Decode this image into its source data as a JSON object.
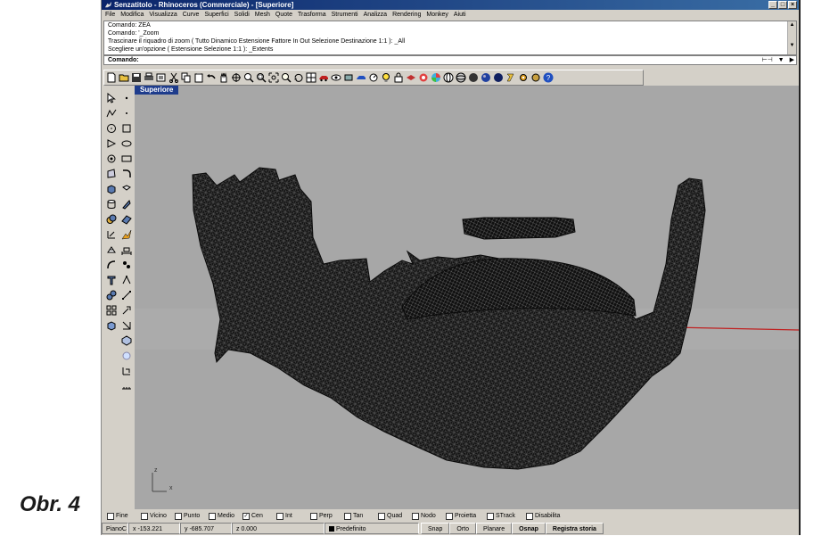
{
  "caption": "Obr. 4",
  "window": {
    "title": "Senzatitolo - Rhinoceros (Commerciale) - [Superiore]",
    "buttons": [
      "_",
      "□",
      "×"
    ]
  },
  "menu": [
    "File",
    "Modifica",
    "Visualizza",
    "Curve",
    "Superfici",
    "Solidi",
    "Mesh",
    "Quote",
    "Trasforma",
    "Strumenti",
    "Analizza",
    "Rendering",
    "Monkey",
    "Aiuti"
  ],
  "command_history": [
    "Comando: ZEA",
    "Comando: '_Zoom",
    "Trascinare il riquadro di zoom ( Tutto  Dinamico  Estensione  Fattore  In  Out  Selezione  Destinazione  1:1 ): _All",
    "Scegliere un'opzione ( Estensione  Selezione  1:1 ): _Extents"
  ],
  "command_prompt": "Comando:",
  "viewport": {
    "title": "Superiore",
    "axis_z": "z",
    "axis_x": "x"
  },
  "osnaps": [
    {
      "label": "Fine",
      "checked": false
    },
    {
      "label": "Vicino",
      "checked": false
    },
    {
      "label": "Punto",
      "checked": false
    },
    {
      "label": "Medio",
      "checked": false
    },
    {
      "label": "Cen",
      "checked": true
    },
    {
      "label": "Int",
      "checked": false
    },
    {
      "label": "Perp",
      "checked": false
    },
    {
      "label": "Tan",
      "checked": false
    },
    {
      "label": "Quad",
      "checked": false
    },
    {
      "label": "Nodo",
      "checked": false
    },
    {
      "label": "Proietta",
      "checked": false
    },
    {
      "label": "STrack",
      "checked": false
    },
    {
      "label": "Disabilita",
      "checked": false
    }
  ],
  "status": {
    "plane": "PianoC",
    "x": "x -153.221",
    "y": "y -685.707",
    "z": "z 0.000",
    "layer": "Predefinito",
    "buttons": [
      "Snap",
      "Orto",
      "Planare",
      "Osnap",
      "Registra storia"
    ]
  }
}
